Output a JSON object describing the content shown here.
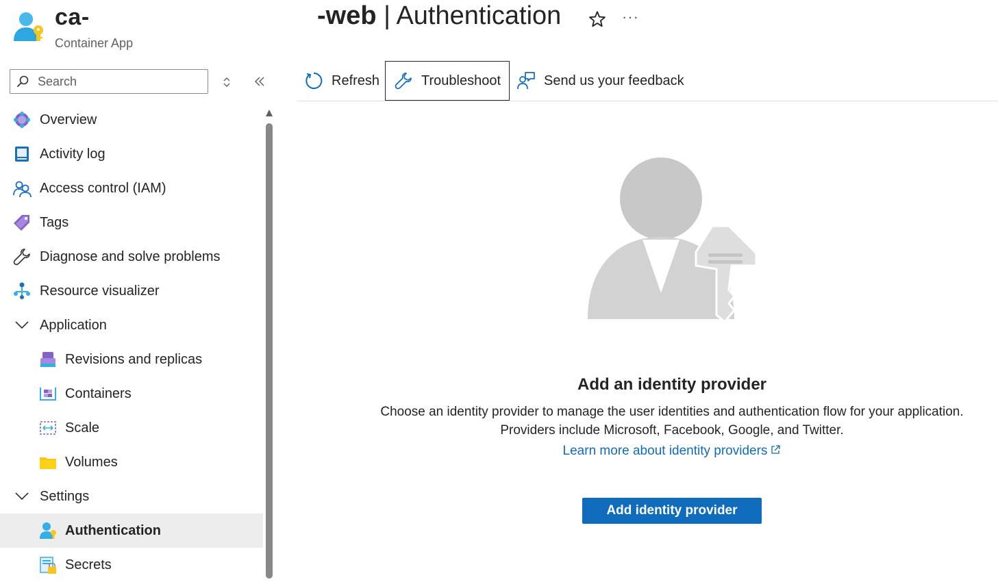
{
  "header": {
    "resource_name": "ca-",
    "resource_type": "Container App",
    "title_prefix": "-web",
    "title_separator": " | ",
    "title_page": "Authentication",
    "favorite_icon": "star-icon",
    "more_label": "···"
  },
  "sidebar": {
    "search_placeholder": "Search",
    "items": [
      {
        "label": "Overview",
        "icon": "overview-icon"
      },
      {
        "label": "Activity log",
        "icon": "activity-log-icon"
      },
      {
        "label": "Access control (IAM)",
        "icon": "iam-icon"
      },
      {
        "label": "Tags",
        "icon": "tag-icon"
      },
      {
        "label": "Diagnose and solve problems",
        "icon": "wrench-icon"
      },
      {
        "label": "Resource visualizer",
        "icon": "visualizer-icon"
      },
      {
        "label": "Application",
        "icon": "chevron-down-icon",
        "expanded": true
      },
      {
        "label": "Revisions and replicas",
        "icon": "revisions-icon"
      },
      {
        "label": "Containers",
        "icon": "containers-icon"
      },
      {
        "label": "Scale",
        "icon": "scale-icon"
      },
      {
        "label": "Volumes",
        "icon": "folder-icon"
      },
      {
        "label": "Settings",
        "icon": "chevron-down-icon",
        "expanded": true
      },
      {
        "label": "Authentication",
        "icon": "authentication-icon",
        "active": true
      },
      {
        "label": "Secrets",
        "icon": "secrets-icon"
      }
    ]
  },
  "toolbar": {
    "refresh_label": "Refresh",
    "troubleshoot_label": "Troubleshoot",
    "feedback_label": "Send us your feedback"
  },
  "main": {
    "empty_title": "Add an identity provider",
    "empty_line1": "Choose an identity provider to manage the user identities and authentication flow for your application.",
    "empty_line2": "Providers include Microsoft, Facebook, Google, and Twitter.",
    "learn_more": "Learn more about identity providers",
    "add_button": "Add identity provider"
  },
  "colors": {
    "accent": "#0f6cbd",
    "active_item_bg": "#ededed",
    "hero_gray": "#d6d6d6"
  }
}
